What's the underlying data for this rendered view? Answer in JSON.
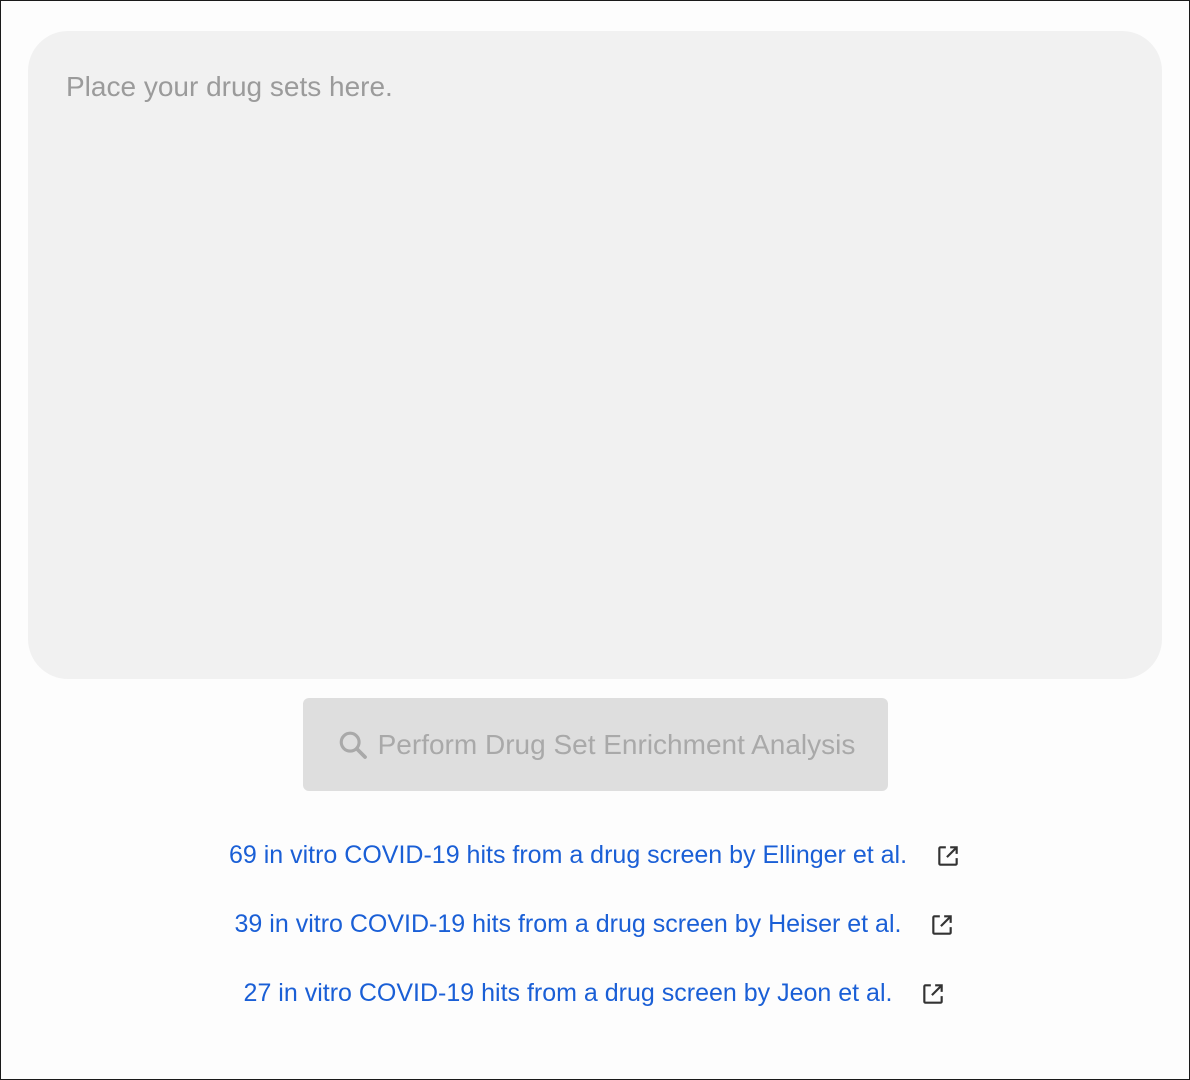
{
  "input": {
    "placeholder": "Place your drug sets here.",
    "value": ""
  },
  "submit": {
    "label": "Perform Drug Set Enrichment Analysis",
    "icon": "search-icon",
    "disabled": true
  },
  "examples": [
    {
      "label": "69 in vitro COVID-19 hits from a drug screen by Ellinger et al.",
      "icon": "external-link-icon"
    },
    {
      "label": "39 in vitro COVID-19 hits from a drug screen by Heiser et al.",
      "icon": "external-link-icon"
    },
    {
      "label": "27 in vitro COVID-19 hits from a drug screen by Jeon et al.",
      "icon": "external-link-icon"
    }
  ],
  "colors": {
    "link": "#1a5fd6",
    "input_background": "#f1f1f1",
    "button_background_disabled": "#dedede",
    "button_text_disabled": "#a9a9a9"
  }
}
